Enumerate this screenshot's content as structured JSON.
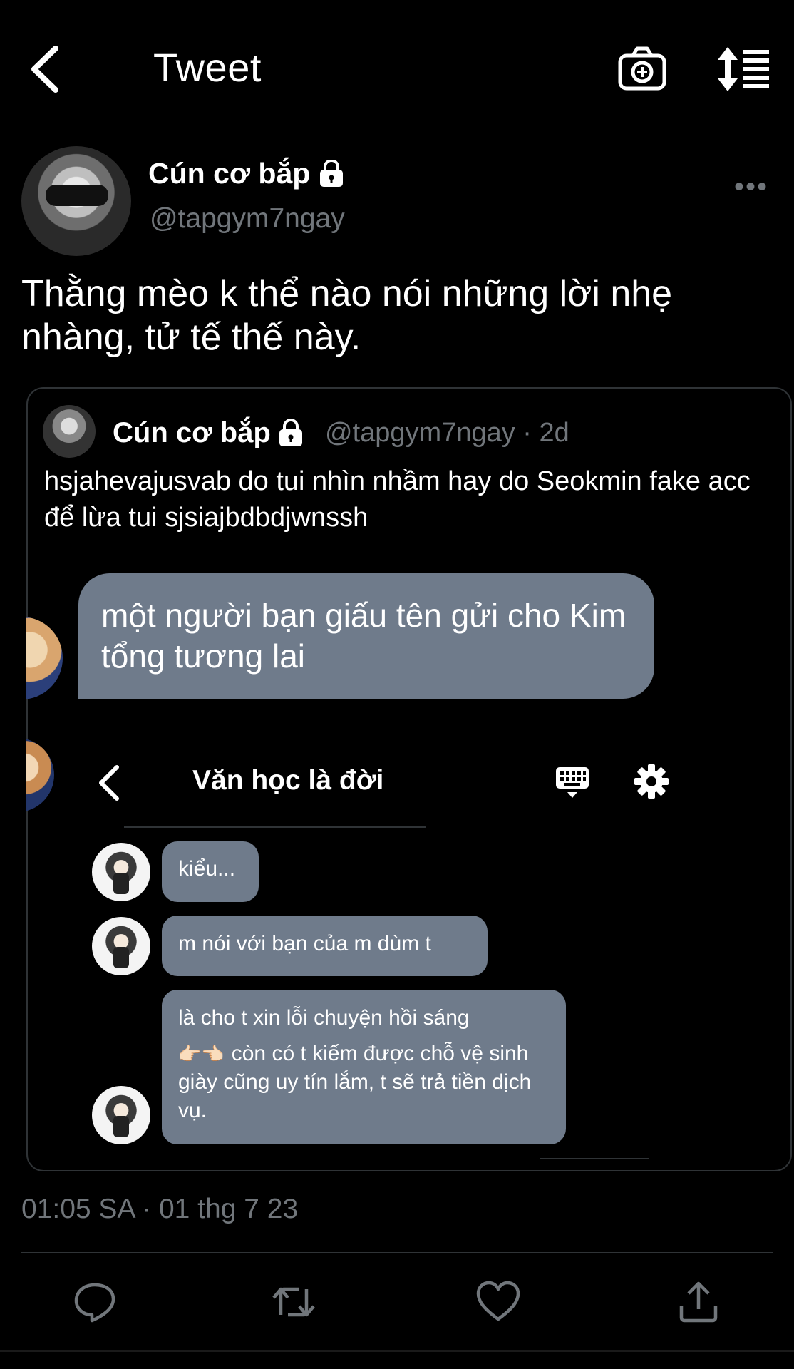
{
  "header": {
    "title": "Tweet"
  },
  "author": {
    "name": "Cún cơ bắp",
    "handle": "@tapgym7ngay",
    "more_label": "•••"
  },
  "tweet": {
    "text": "Thằng mèo k thể nào nói những lời nhẹ nhàng, tử tế thế này.",
    "timestamp": "01:05 SA · 01 thg 7 23"
  },
  "quote": {
    "name": "Cún cơ bắp",
    "handle": "@tapgym7ngay · 2d",
    "text": "hsjahevajusvab do tui nhìn nhầm hay do Seokmin fake acc để lừa tui sjsiajbdbdjwnssh",
    "bubble": "một người bạn giấu tên gửi cho Kim tổng tương lai",
    "inner": {
      "title": "Văn học là đời",
      "messages": [
        "kiểu...",
        "m nói với bạn của m dùm t",
        "là cho t xin lỗi chuyện hồi sáng",
        "👉🏻👈🏻",
        "còn có t kiếm được chỗ vệ sinh giày cũng uy tín lắm, t sẽ trả tiền dịch vụ."
      ]
    }
  },
  "icons": {
    "back": "chevron-left-icon",
    "camera": "camera-plus-icon",
    "sort": "sort-icon",
    "lock": "lock-icon",
    "reply": "reply-icon",
    "retweet": "retweet-icon",
    "like": "heart-icon",
    "share": "share-icon",
    "keyboard": "keyboard-icon",
    "settings": "gear-icon"
  },
  "colors": {
    "background": "#000000",
    "secondary_text": "#71767b",
    "bubble": "#6f7b8b",
    "border": "#2f3336"
  }
}
